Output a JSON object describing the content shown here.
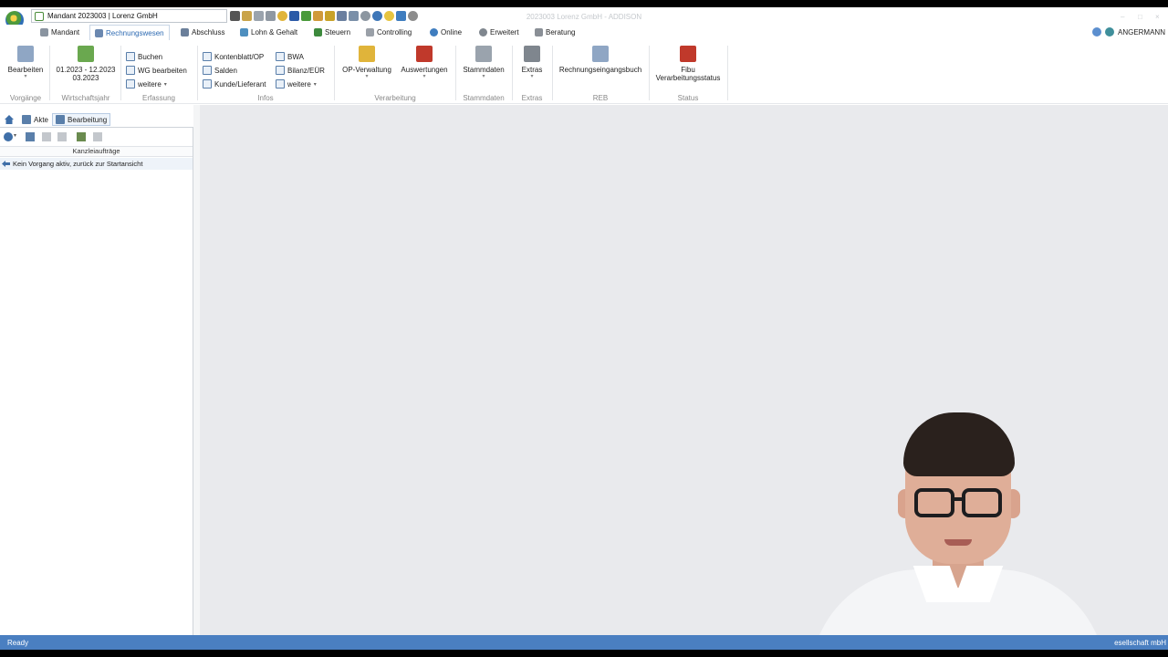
{
  "titlebar": {
    "mandant_box": "Mandant 2023003  |  Lorenz GmbH",
    "window_title": "2023003 Lorenz GmbH - ADDISON",
    "controls": [
      "–",
      "□",
      "×"
    ]
  },
  "menu": {
    "tabs": [
      {
        "label": "Mandant",
        "icon": "mandant-icon"
      },
      {
        "label": "Rechnungswesen",
        "icon": "rechnungswesen-icon",
        "active": true
      },
      {
        "label": "Abschluss",
        "icon": "abschluss-icon"
      },
      {
        "label": "Lohn & Gehalt",
        "icon": "lohn-gehalt-icon"
      },
      {
        "label": "Steuern",
        "icon": "steuern-icon"
      },
      {
        "label": "Controlling",
        "icon": "controlling-icon"
      },
      {
        "label": "Online",
        "icon": "online-icon"
      },
      {
        "label": "Erweitert",
        "icon": "gear-icon"
      },
      {
        "label": "Beratung",
        "icon": "beratung-icon"
      }
    ],
    "user": "ANGERMANN"
  },
  "ribbon": {
    "vorgaenge": {
      "button": "Bearbeiten",
      "group": "Vorgänge"
    },
    "wirtschaftsjahr": {
      "line1": "01.2023 - 12.2023",
      "line2": "03.2023",
      "group": "Wirtschaftsjahr"
    },
    "erfassung": {
      "items": [
        "Buchen",
        "WG bearbeiten",
        "weitere"
      ],
      "group": "Erfassung"
    },
    "infos": {
      "col1": [
        "Kontenblatt/OP",
        "Salden",
        "Kunde/Lieferant"
      ],
      "col2": [
        "BWA",
        "Bilanz/EÜR",
        "weitere"
      ],
      "group": "Infos"
    },
    "verarbeitung": {
      "buttons": [
        "OP-Verwaltung",
        "Auswertungen"
      ],
      "group": "Verarbeitung"
    },
    "stammdaten": {
      "button": "Stammdaten",
      "group": "Stammdaten"
    },
    "extras": {
      "button": "Extras",
      "group": "Extras"
    },
    "reb": {
      "button": "Rechnungseingangsbuch",
      "group": "REB"
    },
    "status": {
      "line1": "Fibu",
      "line2": "Verarbeitungsstatus",
      "group": "Status"
    }
  },
  "nav": {
    "tabs": [
      "Akte",
      "Bearbeitung"
    ],
    "active": "Bearbeitung"
  },
  "panel": {
    "column_header": "Kanzleiaufträge",
    "rows": [
      "Kein Vorgang aktiv, zurück zur Startansicht"
    ]
  },
  "statusbar": {
    "left": "Ready",
    "right": "esellschaft mbH"
  },
  "colors": {
    "accent": "#2d6ab2",
    "statusbar": "#4a7fc1",
    "workspace": "#e9eaed"
  }
}
